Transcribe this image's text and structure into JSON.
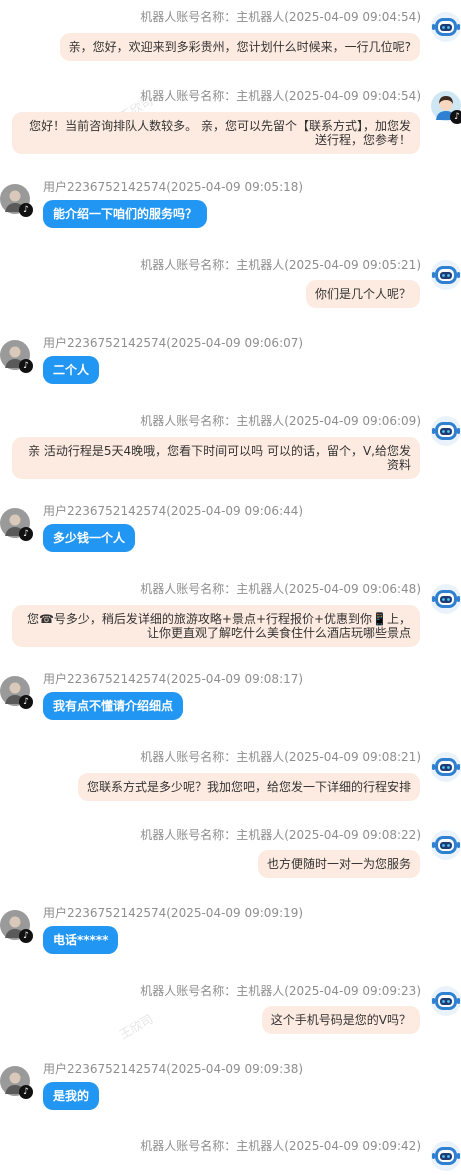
{
  "watermark": "王欣司",
  "messages": [
    {
      "role": "bot",
      "avatar": "robot",
      "meta": "机器人账号名称：主机器人(2025-04-09 09:04:54)",
      "text": "亲，您好，欢迎来到多彩贵州，您计划什么时候来，一行几位呢?"
    },
    {
      "role": "bot",
      "avatar": "agent",
      "meta": "机器人账号名称：主机器人(2025-04-09 09:04:54)",
      "text": "您好！当前咨询排队人数较多。 亲，您可以先留个【联系方式】，加您发送行程，您参考！"
    },
    {
      "role": "user",
      "meta": "用户2236752142574(2025-04-09 09:05:18)",
      "text": "能介绍一下咱们的服务吗？"
    },
    {
      "role": "bot",
      "avatar": "robot",
      "meta": "机器人账号名称：主机器人(2025-04-09 09:05:21)",
      "text": "你们是几个人呢？"
    },
    {
      "role": "user",
      "meta": "用户2236752142574(2025-04-09 09:06:07)",
      "text": "二个人"
    },
    {
      "role": "bot",
      "avatar": "robot",
      "meta": "机器人账号名称：主机器人(2025-04-09 09:06:09)",
      "text": "亲 活动行程是5天4晚哦，您看下时间可以吗 可以的话，留个，V,给您发资料"
    },
    {
      "role": "user",
      "meta": "用户2236752142574(2025-04-09 09:06:44)",
      "text": "多少钱一个人"
    },
    {
      "role": "bot",
      "avatar": "robot",
      "meta": "机器人账号名称：主机器人(2025-04-09 09:06:48)",
      "text": "您☎号多少，稍后发详细的旅游攻略+景点+行程报价+优惠到你📱上，让你更直观了解吃什么美食住什么酒店玩哪些景点"
    },
    {
      "role": "user",
      "meta": "用户2236752142574(2025-04-09 09:08:17)",
      "text": "我有点不懂请介绍细点"
    },
    {
      "role": "bot",
      "avatar": "robot",
      "meta": "机器人账号名称：主机器人(2025-04-09 09:08:21)",
      "text": "您联系方式是多少呢？我加您吧，给您发一下详细的行程安排"
    },
    {
      "role": "bot",
      "avatar": "robot",
      "meta": "机器人账号名称：主机器人(2025-04-09 09:08:22)",
      "text": "也方便随时一对一为您服务"
    },
    {
      "role": "user",
      "meta": "用户2236752142574(2025-04-09 09:09:19)",
      "text": "电话*****"
    },
    {
      "role": "bot",
      "avatar": "robot",
      "meta": "机器人账号名称：主机器人(2025-04-09 09:09:23)",
      "text": "这个手机号码是您的V吗？"
    },
    {
      "role": "user",
      "meta": "用户2236752142574(2025-04-09 09:09:38)",
      "text": "是我的"
    },
    {
      "role": "bot",
      "avatar": "robot",
      "meta": "机器人账号名称：主机器人(2025-04-09 09:09:42)",
      "text": ""
    }
  ]
}
